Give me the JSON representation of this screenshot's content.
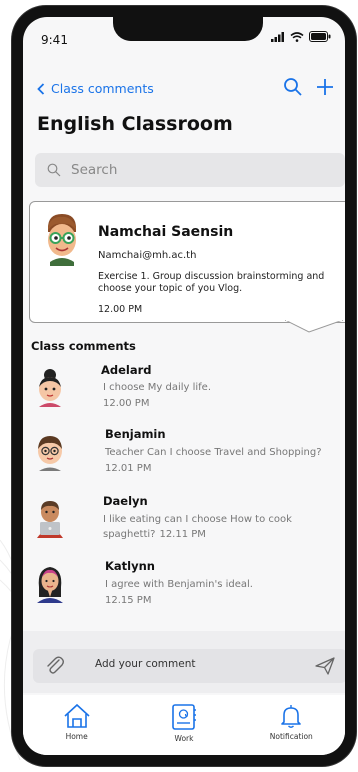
{
  "status_bar": {
    "time": "9:41"
  },
  "header": {
    "back_label": "Class comments",
    "title": "English Classroom"
  },
  "search": {
    "placeholder": "Search"
  },
  "post": {
    "author": "Namchai Saensin",
    "email": "Namchai@mh.ac.th",
    "body": "Exercise 1. Group discussion brainstorming and choose your topic of you Vlog.",
    "time": "12.00 PM"
  },
  "comments_section": {
    "title": "Class comments",
    "items": [
      {
        "name": "Adelard",
        "text": "I choose My daily life.",
        "time": "12.00 PM"
      },
      {
        "name": "Benjamin",
        "text": "Teacher Can I choose Travel and Shopping?",
        "time": "12.01 PM"
      },
      {
        "name": "Daelyn",
        "text": "I like eating can I choose How to cook spaghetti?",
        "time": "12.11 PM"
      },
      {
        "name": "Katlynn",
        "text": "I agree with Benjamin's ideal.",
        "time": "12.15 PM"
      }
    ]
  },
  "composer": {
    "placeholder": "Add your comment"
  },
  "tabbar": {
    "items": [
      {
        "label": "Home"
      },
      {
        "label": "Work"
      },
      {
        "label": "Notification"
      }
    ]
  },
  "colors": {
    "accent": "#1a73e8",
    "background": "#f7f7f8"
  },
  "icons": [
    "back-chevron-icon",
    "search-icon",
    "plus-icon",
    "paperclip-icon",
    "send-icon",
    "home-icon",
    "work-icon",
    "bell-icon",
    "signal-icon",
    "wifi-icon",
    "battery-icon"
  ]
}
